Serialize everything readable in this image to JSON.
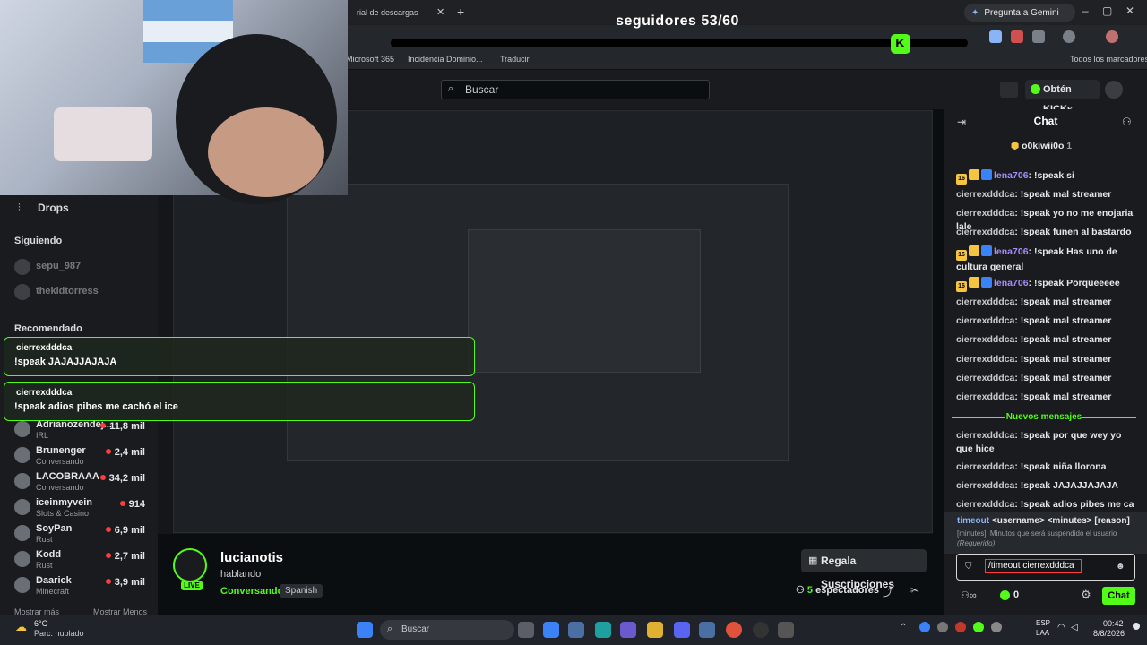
{
  "browser": {
    "tab_title": "rial de descargas",
    "gemini_label": "Pregunta a Gemini",
    "new_tab": "+",
    "bookmarks": [
      "Microsoft 365",
      "Incidencia Dominio...",
      "Traducir"
    ],
    "all_bookmarks": "Todos los marcadores"
  },
  "overlay": {
    "follow_title": "seguidores 53/60",
    "progress": 0.883
  },
  "topnav": {
    "search_placeholder": "Buscar",
    "kicks_button": "Obtén KICKs"
  },
  "sidebar": {
    "drops": "Drops",
    "following_header": "Siguiendo",
    "following": [
      {
        "name": "sepu_987"
      },
      {
        "name": "thekidtorress"
      }
    ],
    "recommended_header": "Recomendado",
    "recommended": [
      {
        "name": "Adrianozendej...",
        "sub": "IRL",
        "viewers": "11,8 mil"
      },
      {
        "name": "Brunenger",
        "sub": "Conversando",
        "viewers": "2,4 mil"
      },
      {
        "name": "LACOBRAAA",
        "sub": "Conversando",
        "viewers": "34,2 mil"
      },
      {
        "name": "iceinmyvein",
        "sub": "Slots & Casino",
        "viewers": "914"
      },
      {
        "name": "SoyPan",
        "sub": "Rust",
        "viewers": "6,9 mil"
      },
      {
        "name": "Kodd",
        "sub": "Rust",
        "viewers": "2,7 mil"
      },
      {
        "name": "Daarick",
        "sub": "Minecraft",
        "viewers": "3,9 mil"
      }
    ],
    "show_more": "Mostrar más",
    "show_less": "Mostrar Menos"
  },
  "toasts": [
    {
      "user": "cierrexdddca",
      "message": "!speak JAJAJJAJAJA"
    },
    {
      "user": "cierrexdddca",
      "message": "!speak adios pibes me cachó el ice"
    }
  ],
  "stream": {
    "streamer": "lucianotis",
    "live": "LIVE",
    "title": "hablando",
    "category": "Conversando",
    "language": "Spanish",
    "gift_button": "Regala Suscripciones",
    "viewers_count": "5",
    "viewers_label": "espectadores"
  },
  "chat": {
    "title": "Chat",
    "pinned_user": "o0kiwii0o",
    "pinned_count": "1",
    "messages": [
      {
        "user": "lena706",
        "text": "!speak si",
        "badged": true
      },
      {
        "user": "cierrexdddca",
        "text": "!speak mal streamer"
      },
      {
        "user": "cierrexdddca",
        "text": "!speak yo no me enojaria lale"
      },
      {
        "user": "cierrexdddca",
        "text": "!speak funen al bastardo"
      },
      {
        "user": "lena706",
        "text": "!speak Has uno de cultura general",
        "badged": true
      },
      {
        "user": "lena706",
        "text": "!speak Porqueeeee",
        "badged": true
      },
      {
        "user": "cierrexdddca",
        "text": "!speak mal streamer"
      },
      {
        "user": "cierrexdddca",
        "text": "!speak mal streamer"
      },
      {
        "user": "cierrexdddca",
        "text": "!speak mal streamer"
      },
      {
        "user": "cierrexdddca",
        "text": "!speak mal streamer"
      },
      {
        "user": "cierrexdddca",
        "text": "!speak mal streamer"
      },
      {
        "user": "cierrexdddca",
        "text": "!speak mal streamer"
      }
    ],
    "new_messages": "Nuevos mensajes",
    "new": [
      {
        "user": "cierrexdddca",
        "text": "!speak por que wey yo que hice"
      },
      {
        "user": "cierrexdddca",
        "text": "!speak niña llorona"
      },
      {
        "user": "cierrexdddca",
        "text": "!speak JAJAJJAJAJA"
      },
      {
        "user": "cierrexdddca",
        "text": "!speak adios pibes me cachó"
      }
    ],
    "command": {
      "name": "timeout",
      "args": "<username> <minutes> [reason]",
      "help": "[minutes]: Minutos que será suspendido el usuario",
      "required": "(Requerido)"
    },
    "input_value": "/timeout cierrexdddca",
    "footer_kicks": "0",
    "send_button": "Chat",
    "badge_number": "16"
  },
  "taskbar": {
    "weather_temp": "6°C",
    "weather_desc": "Parc. nublado",
    "search": "Buscar",
    "lang_top": "ESP",
    "lang_bottom": "LAA",
    "time": "00:42",
    "date": "8/8/2026"
  },
  "colors": {
    "accent": "#53fc18",
    "bg": "#0b0e11",
    "panel": "#191b1f"
  }
}
